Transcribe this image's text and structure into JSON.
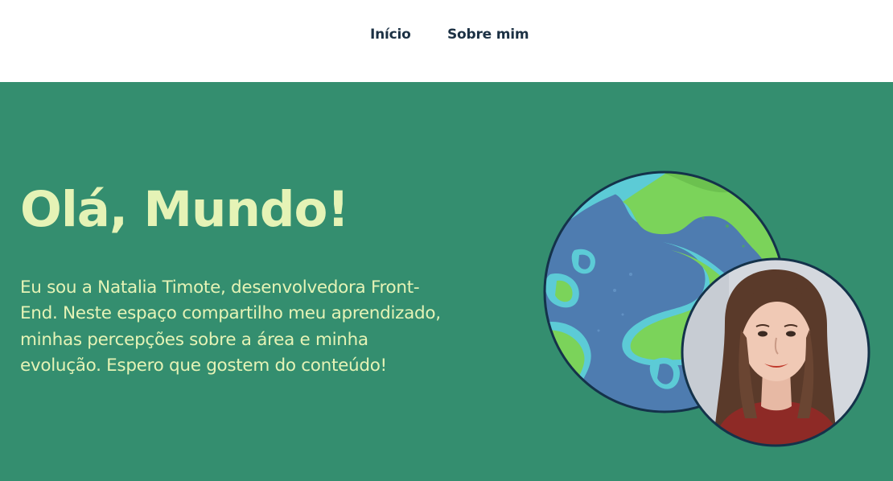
{
  "nav": {
    "items": [
      {
        "label": "Início"
      },
      {
        "label": "Sobre mim"
      }
    ]
  },
  "hero": {
    "title": "Olá, Mundo!",
    "description": "Eu sou a Natalia Timote, desenvolvedora Front-End. Neste espaço compartilho meu aprendizado, minhas percepções sobre a área e minha evolução. Espero que gostem do conteúdo!"
  },
  "colors": {
    "hero_background": "#348e6f",
    "hero_text": "#e5f3b6",
    "nav_text": "#1c3144",
    "globe_land": "#7bd35a",
    "globe_water": "#4e7cb0",
    "globe_shore": "#5ccbd6",
    "outline": "#14324a"
  },
  "icons": {
    "globe": "globe-illustration",
    "avatar": "profile-photo"
  }
}
